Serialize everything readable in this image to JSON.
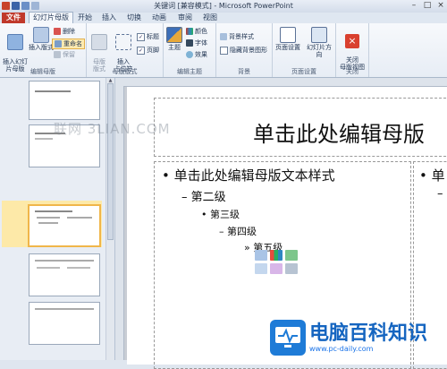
{
  "window": {
    "title": "关键词 [兼容模式] - Microsoft PowerPoint"
  },
  "tabs": [
    {
      "label": "文件"
    },
    {
      "label": "幻灯片母版"
    },
    {
      "label": "开始"
    },
    {
      "label": "插入"
    },
    {
      "label": "切换"
    },
    {
      "label": "动画"
    },
    {
      "label": "审阅"
    },
    {
      "label": "视图"
    }
  ],
  "ribbon": {
    "edit_master": {
      "group_label": "编辑母版",
      "insert_master": "插入幻灯\n片母版",
      "insert_layout": "插入版式",
      "delete": "删除",
      "rename": "重命名",
      "preserve": "保留"
    },
    "master_layout": {
      "group_label": "母版版式",
      "master_layout": "母版\n版式",
      "insert_placeholder": "插入\n占位符",
      "title_chk": "标题",
      "footer_chk": "页脚"
    },
    "edit_theme": {
      "group_label": "编辑主题",
      "theme": "主题",
      "colors": "颜色",
      "fonts": "字体",
      "effects": "效果"
    },
    "background": {
      "group_label": "背景",
      "bg_styles": "背景样式",
      "hide_bg": "隐藏背景图形"
    },
    "page_setup": {
      "group_label": "页面设置",
      "page_setup": "页面设置",
      "orientation": "幻灯片方向"
    },
    "close": {
      "group_label": "关闭",
      "close_master": "关闭\n母版视图"
    }
  },
  "slide": {
    "title": "单击此处编辑母版",
    "levels": [
      "单击此处编辑母版文本样式",
      "第二级",
      "第三级",
      "第四级",
      "第五级"
    ],
    "right_col_bullet": "单"
  },
  "watermark": {
    "text": "联网 3LIAN.COM"
  },
  "logo": {
    "name": "电脑百科知识",
    "url": "www.pc-daily.com"
  },
  "colors": {
    "file_tab": "#c0392b",
    "selection": "#fde9a8",
    "logo_blue": "#1e7bd7"
  }
}
